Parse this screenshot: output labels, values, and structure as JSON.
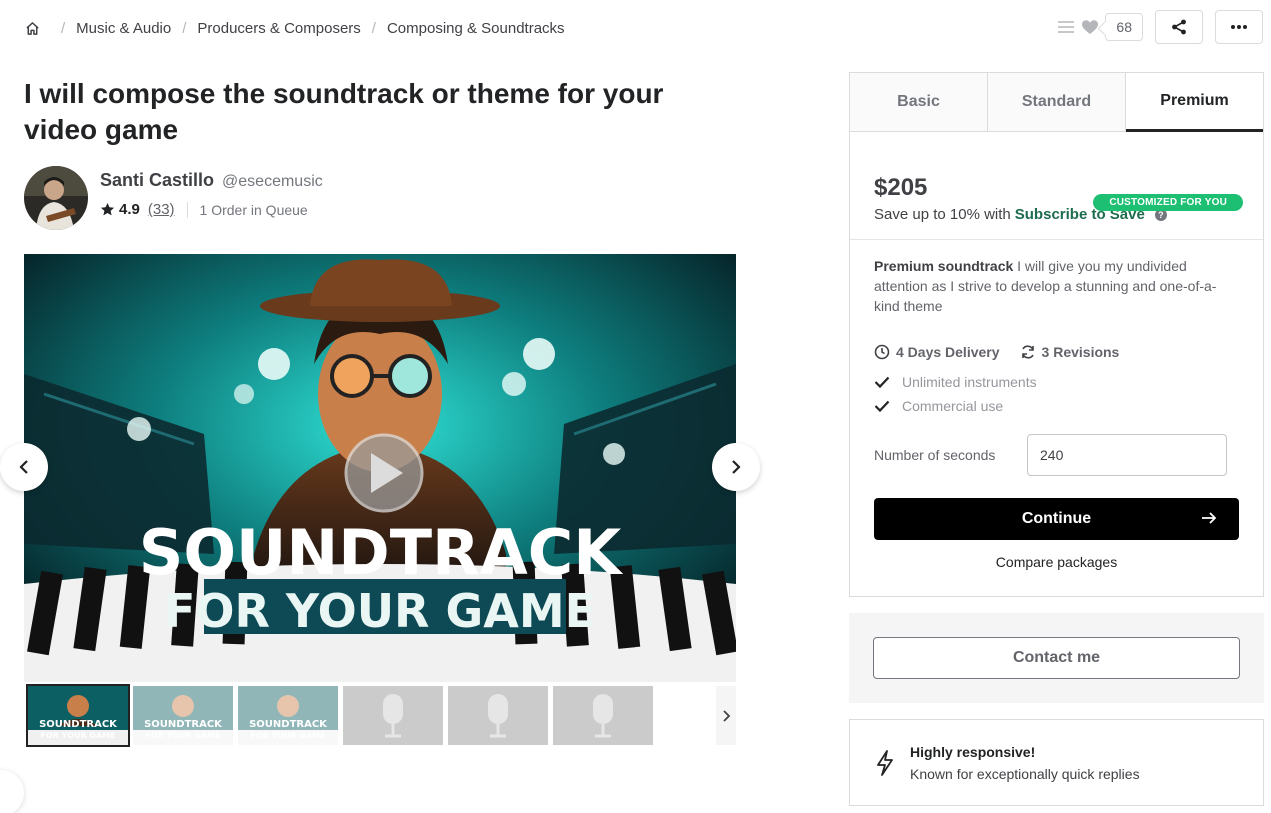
{
  "breadcrumb": {
    "items": [
      "Music & Audio",
      "Producers & Composers",
      "Composing & Soundtracks"
    ]
  },
  "actions": {
    "save_count": "68"
  },
  "gig": {
    "title": "I will compose the soundtrack or theme for your video game"
  },
  "seller": {
    "name": "Santi Castillo",
    "handle": "@esecemusic",
    "rating": "4.9",
    "reviews": "(33)",
    "queue": "1 Order in Queue"
  },
  "gallery": {
    "title_line1": "SOUNDTRACK",
    "title_line2": "FOR YOUR GAME",
    "thumb_line1": "SOUNDTRACK",
    "thumb_line2": "FOR YOUR GAME"
  },
  "package": {
    "tabs": [
      "Basic",
      "Standard",
      "Premium"
    ],
    "active_tab": "Premium",
    "badge": "CUSTOMIZED FOR YOU",
    "price": "$205",
    "save_prefix": "Save up to 10% with",
    "save_link": "Subscribe to Save",
    "desc_title": "Premium soundtrack",
    "desc_text": "I will give you my undivided attention as I strive to develop a stunning and one-of-a-kind theme",
    "delivery": "4 Days Delivery",
    "revisions": "3 Revisions",
    "features": [
      "Unlimited instruments",
      "Commercial use"
    ],
    "qty_label": "Number of seconds",
    "qty_value": "240",
    "continue": "Continue",
    "compare": "Compare packages"
  },
  "contact": {
    "label": "Contact me"
  },
  "responsive": {
    "title": "Highly responsive!",
    "text": "Known for exceptionally quick replies"
  },
  "colors": {
    "accent_green": "#1dbf73",
    "link_green": "#1e6c4e",
    "cta_black": "#000000"
  }
}
